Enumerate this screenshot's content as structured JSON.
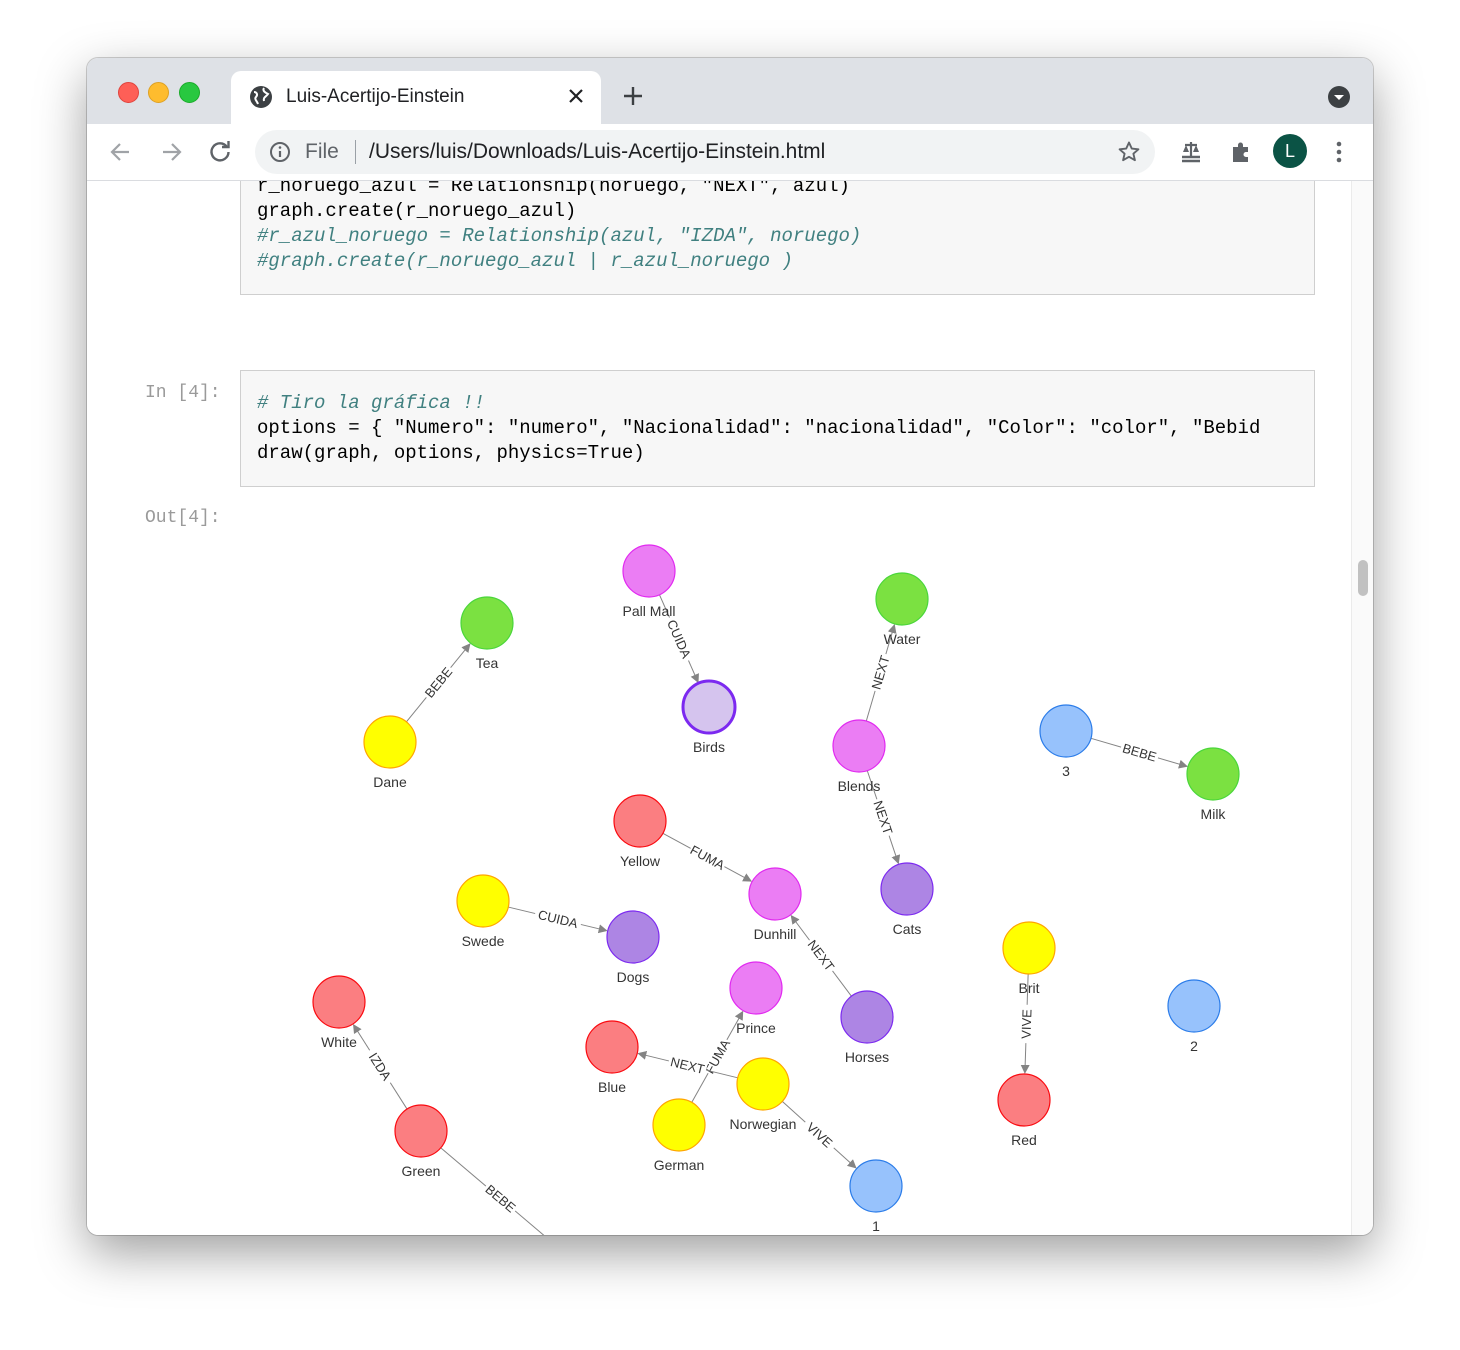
{
  "browser": {
    "tab_title": "Luis-Acertijo-Einstein",
    "omnibox_scheme": "File",
    "omnibox_url": "/Users/luis/Downloads/Luis-Acertijo-Einstein.html",
    "profile_initial": "L"
  },
  "notebook": {
    "cell3_lines": [
      "r_noruego_azul = Relationship(noruego, \"NEXT\", azul)",
      "graph.create(r_noruego_azul)",
      "#r_azul_noruego = Relationship(azul, \"IZDA\", noruego)",
      "#graph.create(r_noruego_azul | r_azul_noruego )"
    ],
    "cell4_prompt": "In [4]:",
    "cell4_lines": [
      "# Tiro la gráfica !!",
      "options = { \"Numero\": \"numero\", \"Nacionalidad\": \"nacionalidad\", \"Color\": \"color\", \"Bebid",
      "draw(graph, options, physics=True)"
    ],
    "out4_prompt": "Out[4]:"
  },
  "graph": {
    "colors": {
      "number": "#97c2fc",
      "number_border": "#2b7ce9",
      "drink": "#7be141",
      "drink_border": "#4ad63a",
      "nationality": "#ffff00",
      "nationality_border": "#ffa500",
      "color": "#fb7e81",
      "color_border": "#fa0a10",
      "smoke": "#eb7df4",
      "smoke_border": "#e129f0",
      "pet": "#ad85e4",
      "pet_border": "#7c29f0",
      "selected_pet": "#d5c4ee",
      "selected_pet_border": "#7c29f0"
    },
    "nodes": [
      {
        "id": "pall-mall",
        "label": "Pall Mall",
        "kind": "smoke"
      },
      {
        "id": "tea",
        "label": "Tea",
        "kind": "drink"
      },
      {
        "id": "water",
        "label": "Water",
        "kind": "drink"
      },
      {
        "id": "birds",
        "label": "Birds",
        "kind": "selected_pet"
      },
      {
        "id": "dane",
        "label": "Dane",
        "kind": "nationality"
      },
      {
        "id": "blends",
        "label": "Blends",
        "kind": "smoke"
      },
      {
        "id": "n3",
        "label": "3",
        "kind": "number"
      },
      {
        "id": "milk",
        "label": "Milk",
        "kind": "drink"
      },
      {
        "id": "yellow",
        "label": "Yellow",
        "kind": "color"
      },
      {
        "id": "dunhill",
        "label": "Dunhill",
        "kind": "smoke"
      },
      {
        "id": "cats",
        "label": "Cats",
        "kind": "pet"
      },
      {
        "id": "swede",
        "label": "Swede",
        "kind": "nationality"
      },
      {
        "id": "dogs",
        "label": "Dogs",
        "kind": "pet"
      },
      {
        "id": "brit",
        "label": "Brit",
        "kind": "nationality"
      },
      {
        "id": "n2",
        "label": "2",
        "kind": "number"
      },
      {
        "id": "white",
        "label": "White",
        "kind": "color"
      },
      {
        "id": "prince",
        "label": "Prince",
        "kind": "smoke"
      },
      {
        "id": "horses",
        "label": "Horses",
        "kind": "pet"
      },
      {
        "id": "blue",
        "label": "Blue",
        "kind": "color"
      },
      {
        "id": "norwegian",
        "label": "Norwegian",
        "kind": "nationality"
      },
      {
        "id": "red",
        "label": "Red",
        "kind": "color"
      },
      {
        "id": "green",
        "label": "Green",
        "kind": "color"
      },
      {
        "id": "german",
        "label": "German",
        "kind": "nationality"
      },
      {
        "id": "n1",
        "label": "1",
        "kind": "number"
      },
      {
        "id": "hidden-bottom",
        "label": "",
        "kind": "number"
      }
    ],
    "edges": [
      {
        "from": "dane",
        "to": "tea",
        "label": "BEBE"
      },
      {
        "from": "pall-mall",
        "to": "birds",
        "label": "CUIDA"
      },
      {
        "from": "blends",
        "to": "water",
        "label": "NEXT"
      },
      {
        "from": "n3",
        "to": "milk",
        "label": "BEBE"
      },
      {
        "from": "blends",
        "to": "cats",
        "label": "NEXT"
      },
      {
        "from": "yellow",
        "to": "dunhill",
        "label": "FUMA"
      },
      {
        "from": "swede",
        "to": "dogs",
        "label": "CUIDA"
      },
      {
        "from": "horses",
        "to": "dunhill",
        "label": "NEXT"
      },
      {
        "from": "brit",
        "to": "red",
        "label": "VIVE"
      },
      {
        "from": "green",
        "to": "white",
        "label": "IZDA"
      },
      {
        "from": "german",
        "to": "prince",
        "label": "FUMA"
      },
      {
        "from": "norwegian",
        "to": "blue",
        "label": "NEXT"
      },
      {
        "from": "norwegian",
        "to": "n1",
        "label": "VIVE"
      },
      {
        "from": "green",
        "to": "hidden-bottom",
        "label": "BEBE"
      }
    ]
  }
}
